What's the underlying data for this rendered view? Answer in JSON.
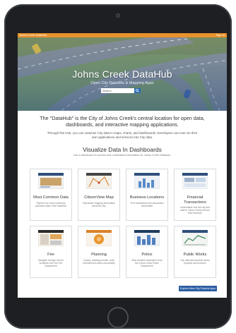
{
  "topbar": {
    "brand": "Johns Creek DataHub",
    "signin": "Sign In"
  },
  "hero": {
    "title": "Johns Creek DataHub",
    "subtitle": "Open City Datasets & Mapping Apps",
    "search_placeholder": "Search"
  },
  "intro": {
    "lead": "The \"DataHub\" is the City of Johns Creek's central location for open data, dashboards, and interactive mapping applications.",
    "body": "Through this Hub, you can view/use City data in maps, charts, and dashboards. Developers can even tie their own applications and services into City data."
  },
  "dashboards": {
    "title": "Visualize Data In Dashboards",
    "subtitle": "Use a dashboard to access and understand information for Johns Creek Datasets.",
    "cards": [
      {
        "label": "Most Common Data",
        "desc": "Explore our most commonly accessed data in the DataHub"
      },
      {
        "label": "CitizenView Map",
        "desc": "Interactive mapping information about the city"
      },
      {
        "label": "Business Locations",
        "desc": "Find businesses and associated information"
      },
      {
        "label": "Financial Transactions",
        "desc": "Understand how the city and staff of Johns Creek perform their finances"
      },
      {
        "label": "Fire",
        "desc": "Navigate through the fire incidents from the Fire Department"
      },
      {
        "label": "Planning",
        "desc": "Zoning, building permits, code enforcement cases and activity"
      },
      {
        "label": "Police",
        "desc": "View incident information from the Johns Creek Police Department"
      },
      {
        "label": "Public Works",
        "desc": "City data about public works projects and services"
      }
    ]
  },
  "explore_button": "Explore More City Projects Apps",
  "colors": {
    "accent": "#e8912d",
    "link": "#2d5fa3",
    "hero_overlay": "#3f6ea8"
  }
}
